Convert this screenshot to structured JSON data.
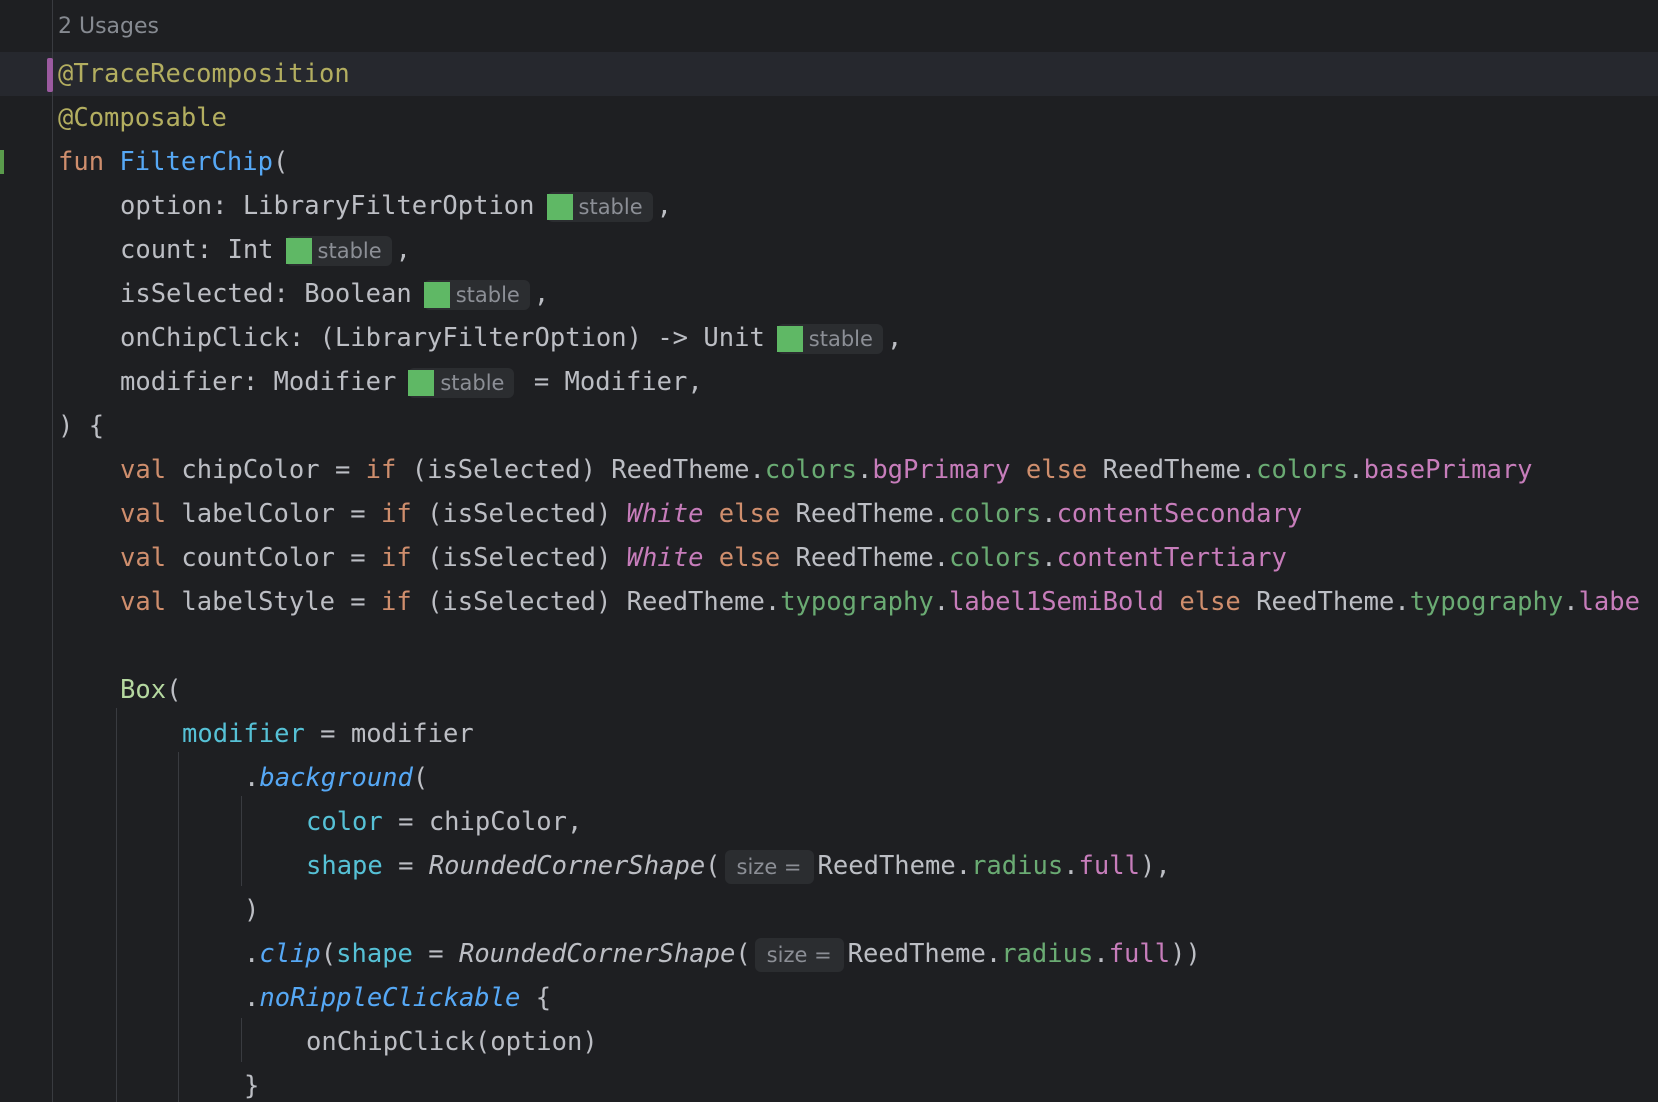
{
  "editor": {
    "usages_label": "2 Usages",
    "badge_label": "stable",
    "hint_size": "size =",
    "lines": {
      "l1_ann": "@TraceRecomposition",
      "l2_ann": "@Composable",
      "l3_kw": "fun",
      "l3_fn": "FilterChip",
      "l3_rest": "(",
      "l4_a": "option: LibraryFilterOption",
      "l4_b": ",",
      "l5_a": "count: Int",
      "l5_b": ",",
      "l6_a": "isSelected: Boolean",
      "l6_b": ",",
      "l7_a": "onChipClick: (LibraryFilterOption) -> Unit",
      "l7_b": ",",
      "l8_a": "modifier: Modifier",
      "l8_b": " = Modifier,",
      "l9": ") {",
      "l10_val": "val",
      "l10_a": " chipColor = ",
      "l10_if": "if",
      "l10_b": " (isSelected) ReedTheme.",
      "l10_colors1": "colors",
      "l10_dot1": ".",
      "l10_bg": "bgPrimary",
      "l10_else": "else",
      "l10_c": " ReedTheme.",
      "l10_colors2": "colors",
      "l10_dot2": ".",
      "l10_base": "basePrimary",
      "l11_val": "val",
      "l11_a": " labelColor = ",
      "l11_if": "if",
      "l11_b": " (isSelected) ",
      "l11_white": "White",
      "l11_else": "else",
      "l11_c": " ReedTheme.",
      "l11_colors": "colors",
      "l11_dot": ".",
      "l11_content": "contentSecondary",
      "l12_val": "val",
      "l12_a": " countColor = ",
      "l12_if": "if",
      "l12_b": " (isSelected) ",
      "l12_white": "White",
      "l12_else": "else",
      "l12_c": " ReedTheme.",
      "l12_colors": "colors",
      "l12_dot": ".",
      "l12_content": "contentTertiary",
      "l13_val": "val",
      "l13_a": " labelStyle = ",
      "l13_if": "if",
      "l13_b": " (isSelected) ReedTheme.",
      "l13_typo1": "typography",
      "l13_dot1": ".",
      "l13_label1": "label1SemiBold",
      "l13_else": "else",
      "l13_c": " ReedTheme.",
      "l13_typo2": "typography",
      "l13_dot2": ".",
      "l13_label2": "labe",
      "l14_box": "Box",
      "l14_paren": "(",
      "l15_mod": "modifier",
      "l15_eq": " = modifier",
      "l16_dot": ".",
      "l16_bg": "background",
      "l16_paren": "(",
      "l17_color": "color",
      "l17_eq": " = chipColor,",
      "l18_shape": "shape",
      "l18_eq": " = ",
      "l18_rcs": "RoundedCornerShape",
      "l18_paren": "(",
      "l18_rt": "ReedTheme.",
      "l18_radius": "radius",
      "l18_dot": ".",
      "l18_full": "full",
      "l18_end": "),",
      "l19": ")",
      "l20_dot": ".",
      "l20_clip": "clip",
      "l20_paren": "(",
      "l20_shape": "shape",
      "l20_eq": " = ",
      "l20_rcs": "RoundedCornerShape",
      "l20_paren2": "(",
      "l20_rt": "ReedTheme.",
      "l20_radius": "radius",
      "l20_dot2": ".",
      "l20_full": "full",
      "l20_end": "))",
      "l21_dot": ".",
      "l21_nrc": "noRippleClickable",
      "l21_brace": " {",
      "l22": "onChipClick(option)",
      "l23": "}"
    }
  }
}
